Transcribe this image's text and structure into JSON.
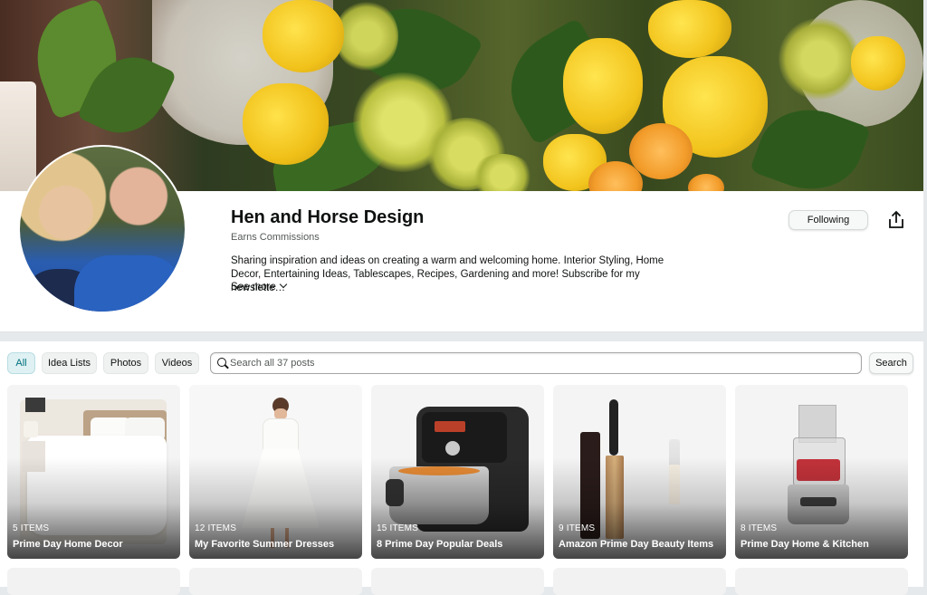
{
  "profile": {
    "name": "Hen and Horse Design",
    "badge": "Earns Commissions",
    "bio": "Sharing inspiration and ideas on creating a warm and welcoming home. Interior Styling, Home Decor, Entertaining Ideas, Tablescapes, Recipes, Gardening and more! Subscribe for my newslette…",
    "see_more": "See more",
    "follow_label": "Following"
  },
  "filters": [
    {
      "label": "All",
      "active": true
    },
    {
      "label": "Idea Lists",
      "active": false
    },
    {
      "label": "Photos",
      "active": false
    },
    {
      "label": "Videos",
      "active": false
    }
  ],
  "search": {
    "placeholder": "Search all 37 posts",
    "button": "Search"
  },
  "cards": [
    {
      "count": "5 ITEMS",
      "title": "Prime Day Home Decor"
    },
    {
      "count": "12 ITEMS",
      "title": "My Favorite Summer Dresses"
    },
    {
      "count": "15 ITEMS",
      "title": "8 Prime Day Popular Deals"
    },
    {
      "count": "9 ITEMS",
      "title": "Amazon Prime Day Beauty Items"
    },
    {
      "count": "8 ITEMS",
      "title": "Prime Day Home & Kitchen"
    }
  ],
  "colors": {
    "accent": "#00707c",
    "chip_active_bg": "#dff1f3",
    "page_bg": "#e6e9eb"
  },
  "icons": [
    "share-icon",
    "search-icon",
    "chevron-down-icon"
  ]
}
